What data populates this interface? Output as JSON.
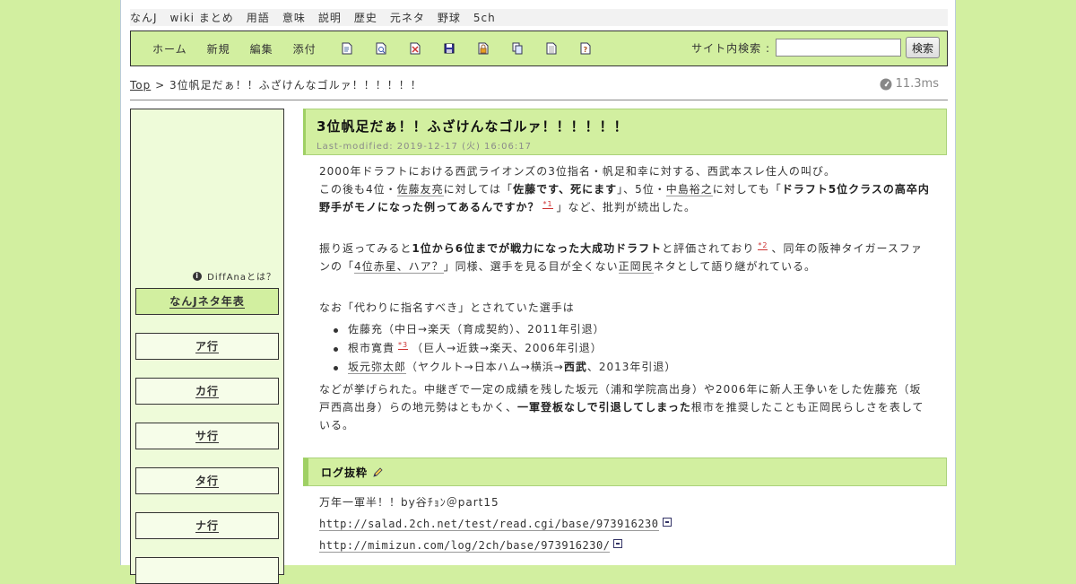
{
  "topnav": [
    "なんJ",
    "wiki まとめ",
    "用語",
    "意味",
    "説明",
    "歴史",
    "元ネタ",
    "野球",
    "5ch"
  ],
  "toolbar": {
    "links": [
      "ホーム",
      "新規",
      "編集",
      "添付"
    ],
    "icons": [
      "page-icon",
      "page-search-icon",
      "page-diff-icon",
      "save-icon",
      "lock-icon",
      "copy-icon",
      "list-icon",
      "help-icon"
    ],
    "search_label": "サイト内検索 :",
    "search_value": "",
    "search_button": "検索"
  },
  "breadcrumb": {
    "top": "Top",
    "sep": ">",
    "current": "3位帆足だぁ！！ふざけんなゴルァ！！！！！！"
  },
  "timer": "11.3ms",
  "sidebar": {
    "help": "DiffAnaとは？",
    "items": [
      "なんJネタ年表",
      "ア行",
      "カ行",
      "サ行",
      "タ行",
      "ナ行",
      ""
    ]
  },
  "article": {
    "title": "3位帆足だぁ！！ふざけんなゴルァ！！！！！！",
    "modified": "Last-modified: 2019-12-17 (火) 16:06:17",
    "p1_line1": "2000年ドラフトにおける西武ライオンズの3位指名・帆足和幸に対する、西武本スレ住人の叫び。",
    "p1_a": "この後も4位・",
    "p1_link1": "佐藤友亮",
    "p1_b": "に対しては「",
    "p1_bold1": "佐藤です、死にます",
    "p1_c": "」、5位・",
    "p1_link2": "中島裕之",
    "p1_d": "に対しても「",
    "p1_bold2": "ドラフト5位クラスの高卒内野手がモノになった例ってあるんですか？",
    "p1_note": "*1",
    "p1_e": "」など、批判が続出した。",
    "p2_a": "振り返ってみると",
    "p2_bold": "1位から6位までが戦力になった大成功ドラフト",
    "p2_b": "と評価されており",
    "p2_note": "*2",
    "p2_c": "、同年の阪神タイガースファンの「",
    "p2_link1": "4位赤星、ハア？",
    "p2_d": "」同様、選手を見る目が全くない",
    "p2_link2": "正岡民",
    "p2_e": "ネタとして語り継がれている。",
    "p3": "なお「代わりに指名すべき」とされていた選手は",
    "players": [
      {
        "name": "佐藤充",
        "detail": "（中日→楽天（育成契約）、2011年引退）",
        "note": "",
        "bold": ""
      },
      {
        "name": "根市寛貴",
        "detail": "（巨人→近鉄→楽天、2006年引退）",
        "note": "*3",
        "bold": ""
      },
      {
        "name": "坂元弥太郎",
        "detail": "（ヤクルト→日本ハム→横浜→",
        "note": "",
        "bold": "西武",
        "tail": "、2013年引退）"
      }
    ],
    "p4_a": "などが挙げられた。中継ぎで一定の成績を残した坂元（浦和学院高出身）や2006年に新人王争いをした佐藤充（坂戸西高出身）らの地元勢はともかく、",
    "p4_bold": "一軍登板なしで引退してしまった",
    "p4_b": "根市を推奨したことも正岡民らしさを表している。"
  },
  "log": {
    "heading": "ログ抜粋",
    "line1": "万年一軍半！！by谷ﾁｮﾝ＠part15",
    "url1": "http://salad.2ch.net/test/read.cgi/base/973916230",
    "url2": "http://mimizun.com/log/2ch/base/973916230/"
  },
  "colors": {
    "page_bg": "#d2efa0",
    "accent": "#9fd064",
    "note": "#cc3333"
  }
}
